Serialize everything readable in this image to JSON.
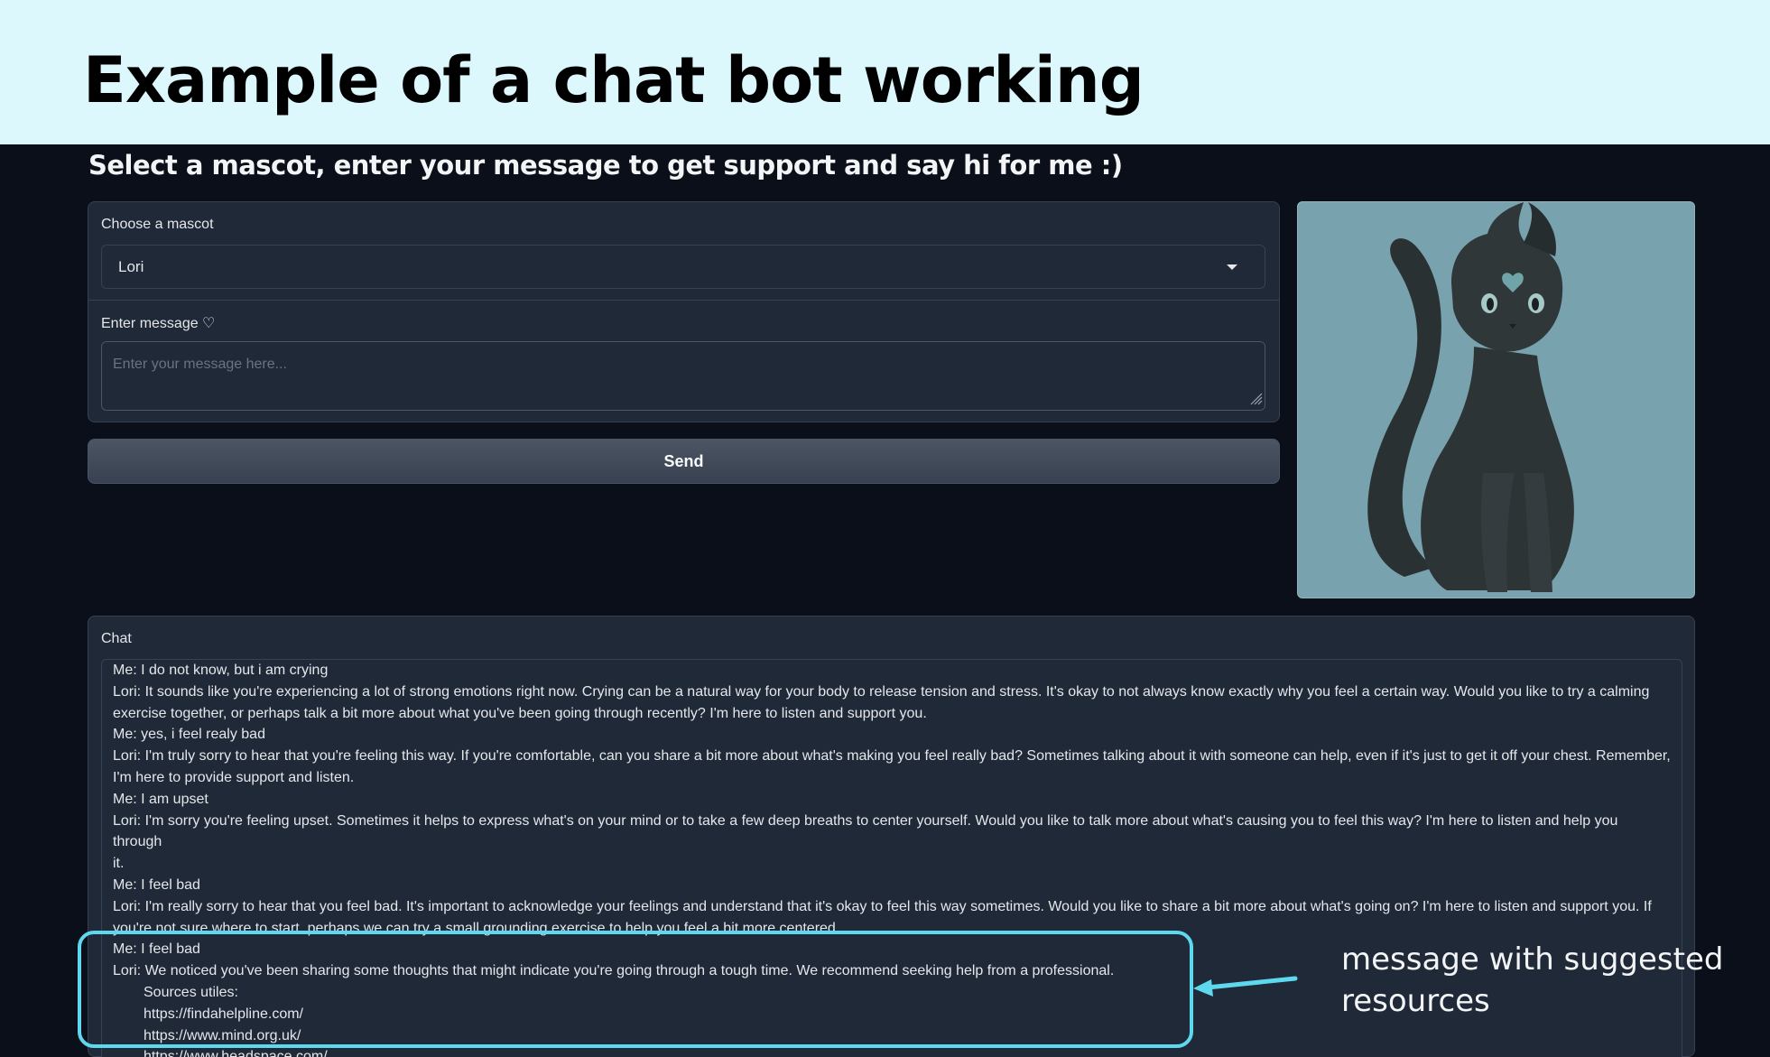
{
  "banner": {
    "title": "Example of a chat bot working"
  },
  "subtitle": "Select a mascot, enter your message to get support and say hi for me :)",
  "mascot_select": {
    "label": "Choose a mascot",
    "value": "Lori"
  },
  "message_input": {
    "label": "Enter message ♡",
    "placeholder": "Enter your message here...",
    "value": ""
  },
  "send_button": {
    "label": "Send"
  },
  "chat": {
    "label": "Chat",
    "lines": [
      "Me: I do not know, but i am crying",
      "Lori: It sounds like you're experiencing a lot of strong emotions right now. Crying can be a natural way for your body to release tension and stress. It's okay to not always know exactly why you feel a certain way. Would you like to try a calming",
      "exercise together, or perhaps talk a bit more about what you've been going through recently? I'm here to listen and support you.",
      "Me: yes, i feel realy bad",
      "Lori: I'm truly sorry to hear that you're feeling this way. If you're comfortable, can you share a bit more about what's making you feel really bad? Sometimes talking about it with someone can help, even if it's just to get it off your chest. Remember,",
      "I'm here to provide support and listen.",
      "Me: I am upset",
      "Lori: I'm sorry you're feeling upset. Sometimes it helps to express what's on your mind or to take a few deep breaths to center yourself. Would you like to talk more about what's causing you to feel this way? I'm here to listen and help you through",
      "it.",
      "Me: I feel bad",
      "Lori: I'm really sorry to hear that you feel bad. It's important to acknowledge your feelings and understand that it's okay to feel this way sometimes. Would you like to share a bit more about what's going on? I'm here to listen and support you. If",
      "you're not sure where to start, perhaps we can try a small grounding exercise to help you feel a bit more centered.",
      "Me: I feel bad",
      "Lori: We noticed you've been sharing some thoughts that might indicate you're going through a tough time. We recommend seeking help from a professional."
    ],
    "sources_lines": [
      "Sources utiles:",
      "https://findahelpline.com/",
      "https://www.mind.org.uk/",
      "https://www.headspace.com/"
    ]
  },
  "annotation": {
    "line1": "message with suggested",
    "line2": "resources",
    "color": "#5ed8ee"
  },
  "colors": {
    "banner_bg": "#dcf8fd",
    "page_bg": "#0b0f19",
    "panel_bg": "#1f2937",
    "mascot_bg": "#78a2ad"
  },
  "icons": {
    "dropdown": "chevron-down-icon",
    "mascot": "black-cat-illustration"
  }
}
